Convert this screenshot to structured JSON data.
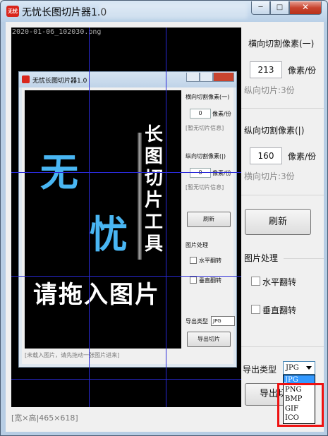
{
  "window": {
    "title": "无忧长图切片器1.0",
    "icon_label": "无忧",
    "buttons": {
      "minimize": "─",
      "maximize": "□",
      "close": "✕"
    }
  },
  "canvas": {
    "file_name": "2020-01-06_102030.png"
  },
  "inner_window": {
    "title": "无忧长图切片器1.0",
    "poster": {
      "word1": "无",
      "word2": "忧",
      "vertical": [
        "长",
        "图",
        "切",
        "片",
        "工",
        "具"
      ],
      "drop_text": "请拖入图片"
    },
    "status": "[未载入图片，请先拖动一张图片进来]",
    "panel": {
      "horizontal_label": "横向切割像素(一)",
      "horizontal_value": "0",
      "unit": "像素/份",
      "horizontal_info": "[暂无切片信息]",
      "vertical_label": "纵向切割像素(|)",
      "vertical_value": "0",
      "vertical_info": "[暂无切片信息]",
      "refresh": "刷新",
      "process_label": "图片处理",
      "flip_h": "水平翻转",
      "flip_v": "垂直翻转",
      "export_label": "导出类型",
      "export_value": "JPG",
      "export_button": "导出切片"
    }
  },
  "panel": {
    "horizontal": {
      "label": "横向切割像素(一)",
      "value": "213",
      "unit": "像素/份",
      "info": "纵向切片:3份"
    },
    "vertical": {
      "label": "纵向切割像素(|)",
      "value": "160",
      "unit": "像素/份",
      "info": "横向切片:3份"
    },
    "refresh_label": "刷新",
    "image_processing": {
      "label": "图片处理",
      "flip_horizontal": "水平翻转",
      "flip_vertical": "垂直翻转"
    },
    "export": {
      "label": "导出类型",
      "selected": "JPG",
      "options": [
        "JPG",
        "PNG",
        "BMP",
        "GIF",
        "ICO"
      ],
      "button_label": "导出切"
    }
  },
  "statusbar": {
    "text": "[宽×高|465×618]"
  },
  "colors": {
    "grid_line": "#2a2ad8",
    "highlight_box": "#ee1111",
    "selected_option": "#3399ff",
    "poster_blue": "#49b6f3"
  }
}
